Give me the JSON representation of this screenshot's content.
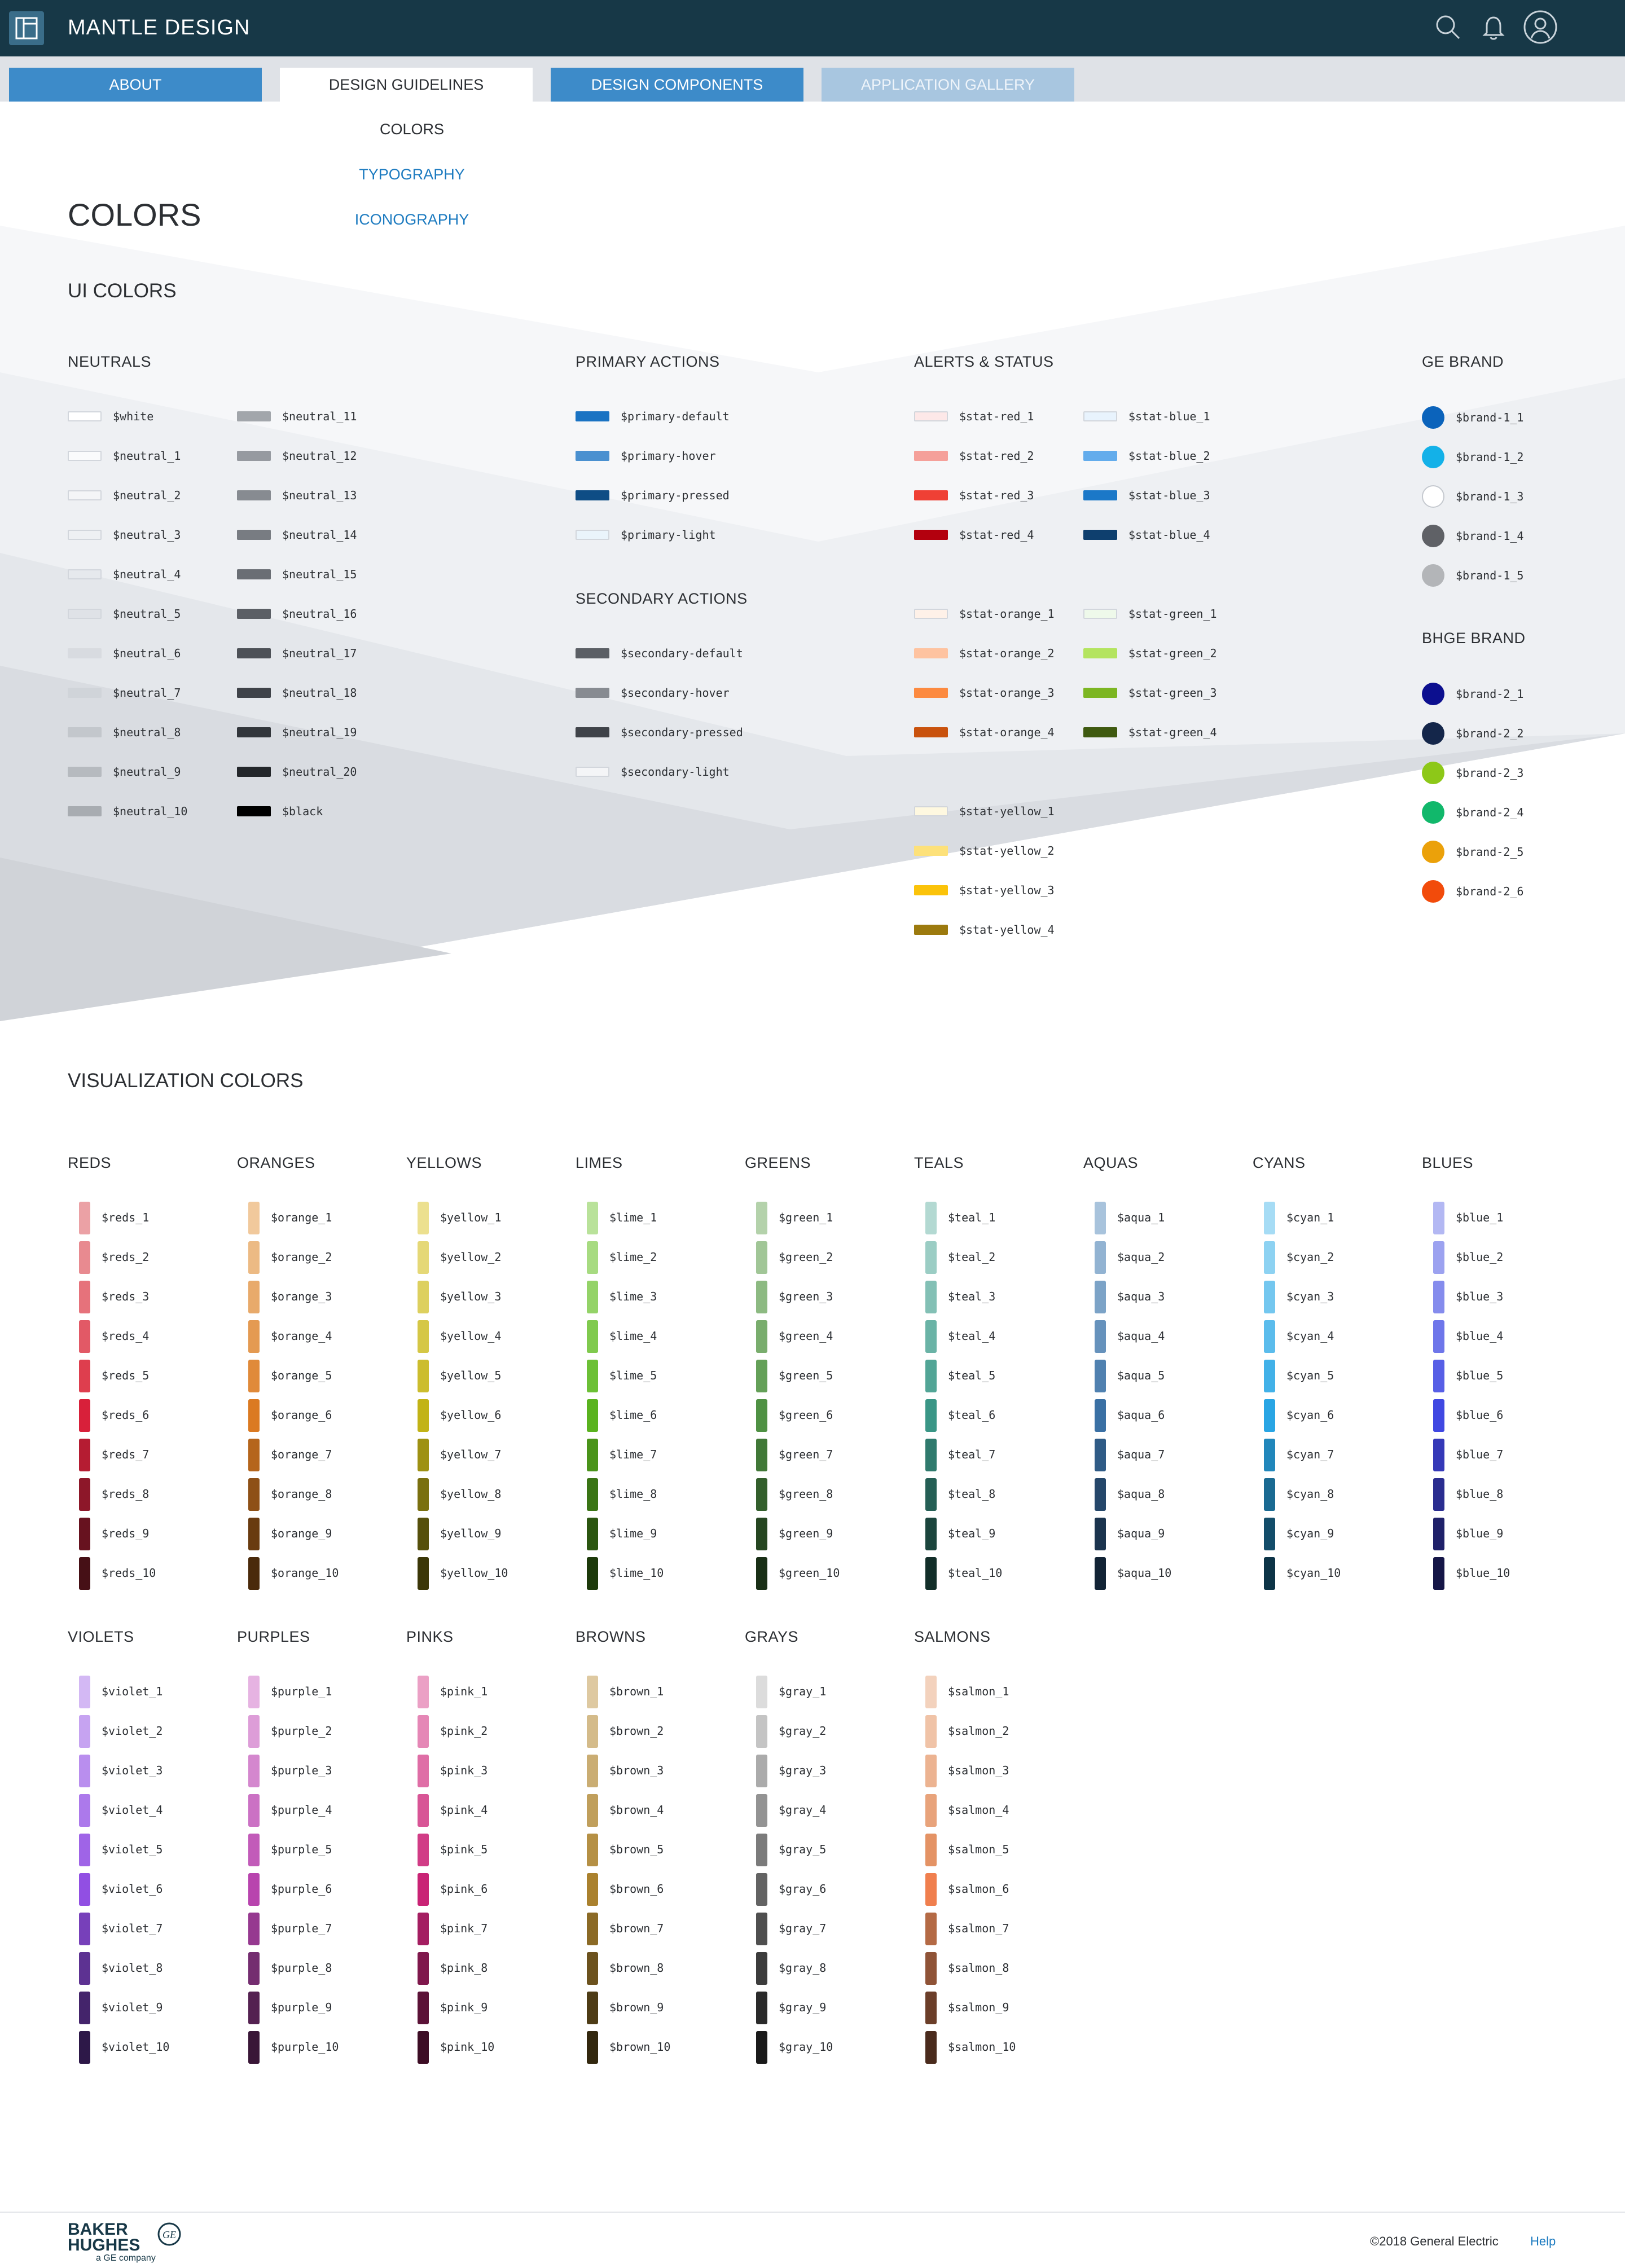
{
  "app": {
    "title": "MANTLE DESIGN"
  },
  "tabs": [
    {
      "label": "ABOUT"
    },
    {
      "label": "DESIGN GUIDELINES"
    },
    {
      "label": "DESIGN COMPONENTS"
    },
    {
      "label": "APPLICATION GALLERY"
    }
  ],
  "subnav": [
    {
      "label": "COLORS"
    },
    {
      "label": "TYPOGRAPHY"
    },
    {
      "label": "ICONOGRAPHY"
    }
  ],
  "page_title": "COLORS",
  "ui_colors": {
    "title": "UI COLORS",
    "neutrals": {
      "title": "NEUTRALS",
      "col1": [
        {
          "label": "$white",
          "color": "#ffffff",
          "outline": true
        },
        {
          "label": "$neutral_1",
          "color": "#fafbfc",
          "outline": true
        },
        {
          "label": "$neutral_2",
          "color": "#f4f5f7",
          "outline": true
        },
        {
          "label": "$neutral_3",
          "color": "#eef0f3",
          "outline": true
        },
        {
          "label": "$neutral_4",
          "color": "#e6e9ed",
          "outline": true
        },
        {
          "label": "$neutral_5",
          "color": "#dfe2e7",
          "outline": true
        },
        {
          "label": "$neutral_6",
          "color": "#d8dbe0"
        },
        {
          "label": "$neutral_7",
          "color": "#d0d4d9"
        },
        {
          "label": "$neutral_8",
          "color": "#c3c7cc"
        },
        {
          "label": "$neutral_9",
          "color": "#b6babf"
        },
        {
          "label": "$neutral_10",
          "color": "#a8acb1"
        }
      ],
      "col2": [
        {
          "label": "$neutral_11",
          "color": "#a2a6ab"
        },
        {
          "label": "$neutral_12",
          "color": "#969aa0"
        },
        {
          "label": "$neutral_13",
          "color": "#878b91"
        },
        {
          "label": "$neutral_14",
          "color": "#787c82"
        },
        {
          "label": "$neutral_15",
          "color": "#6a6e74"
        },
        {
          "label": "$neutral_16",
          "color": "#5b5f65"
        },
        {
          "label": "$neutral_17",
          "color": "#4d5157"
        },
        {
          "label": "$neutral_18",
          "color": "#3f4349"
        },
        {
          "label": "$neutral_19",
          "color": "#32363b"
        },
        {
          "label": "$neutral_20",
          "color": "#24272b"
        },
        {
          "label": "$black",
          "color": "#000000"
        }
      ]
    },
    "primary": {
      "title": "PRIMARY ACTIONS",
      "items": [
        {
          "label": "$primary-default",
          "color": "#1a73c3"
        },
        {
          "label": "$primary-hover",
          "color": "#4a90d0"
        },
        {
          "label": "$primary-pressed",
          "color": "#0e4d85"
        },
        {
          "label": "$primary-light",
          "color": "#eaf4fb",
          "outline": true
        }
      ]
    },
    "secondary": {
      "title": "SECONDARY ACTIONS",
      "items": [
        {
          "label": "$secondary-default",
          "color": "#5b5f65"
        },
        {
          "label": "$secondary-hover",
          "color": "#878b91"
        },
        {
          "label": "$secondary-pressed",
          "color": "#3f4349"
        },
        {
          "label": "$secondary-light",
          "color": "#f4f5f7",
          "outline": true
        }
      ]
    },
    "alerts": {
      "title": "ALERTS & STATUS",
      "col1": [
        {
          "label": "$stat-red_1",
          "color": "#fde8e8",
          "outline": true
        },
        {
          "label": "$stat-red_2",
          "color": "#f5a09a"
        },
        {
          "label": "$stat-red_3",
          "color": "#ef4035"
        },
        {
          "label": "$stat-red_4",
          "color": "#b3000e"
        },
        {
          "label": "$stat-orange_1",
          "color": "#fef1e8",
          "outline": true
        },
        {
          "label": "$stat-orange_2",
          "color": "#fec3a0"
        },
        {
          "label": "$stat-orange_3",
          "color": "#fc8a40"
        },
        {
          "label": "$stat-orange_4",
          "color": "#c9520d"
        },
        {
          "label": "$stat-yellow_1",
          "color": "#fef8e0",
          "outline": true
        },
        {
          "label": "$stat-yellow_2",
          "color": "#fde17a"
        },
        {
          "label": "$stat-yellow_3",
          "color": "#fbc30a"
        },
        {
          "label": "$stat-yellow_4",
          "color": "#9c7a0e"
        }
      ],
      "col2": [
        {
          "label": "$stat-blue_1",
          "color": "#e8f3fd",
          "outline": true
        },
        {
          "label": "$stat-blue_2",
          "color": "#63acec"
        },
        {
          "label": "$stat-blue_3",
          "color": "#1b78c8"
        },
        {
          "label": "$stat-blue_4",
          "color": "#0e3f6e"
        },
        {
          "label": "$stat-green_1",
          "color": "#eef9ea",
          "outline": true
        },
        {
          "label": "$stat-green_2",
          "color": "#b4e45f"
        },
        {
          "label": "$stat-green_3",
          "color": "#7cb622"
        },
        {
          "label": "$stat-green_4",
          "color": "#3f5a10"
        }
      ]
    },
    "ge_brand": {
      "title": "GE BRAND",
      "items": [
        {
          "label": "$brand-1_1",
          "color": "#0b63bb"
        },
        {
          "label": "$brand-1_2",
          "color": "#13b1e8"
        },
        {
          "label": "$brand-1_3",
          "color": "#ffffff",
          "outline": true
        },
        {
          "label": "$brand-1_4",
          "color": "#5f6166"
        },
        {
          "label": "$brand-1_5",
          "color": "#b3b5b8"
        }
      ]
    },
    "bhge_brand": {
      "title": "BHGE BRAND",
      "items": [
        {
          "label": "$brand-2_1",
          "color": "#0c0f8f"
        },
        {
          "label": "$brand-2_2",
          "color": "#14264a"
        },
        {
          "label": "$brand-2_3",
          "color": "#8dc818"
        },
        {
          "label": "$brand-2_4",
          "color": "#11b86b"
        },
        {
          "label": "$brand-2_5",
          "color": "#eba10a"
        },
        {
          "label": "$brand-2_6",
          "color": "#f24b0b"
        }
      ]
    }
  },
  "viz_colors": {
    "title": "VISUALIZATION COLORS",
    "groups": [
      {
        "title": "REDS",
        "labels": [
          "$reds_1",
          "$reds_2",
          "$reds_3",
          "$reds_4",
          "$reds_5",
          "$reds_6",
          "$reds_7",
          "$reds_8",
          "$reds_9",
          "$reds_10"
        ],
        "colors": [
          "#eba1a5",
          "#e88a90",
          "#e6727b",
          "#e25966",
          "#de3e4e",
          "#d8203a",
          "#b51c32",
          "#8d1729",
          "#67121f",
          "#461016"
        ]
      },
      {
        "title": "ORANGES",
        "labels": [
          "$orange_1",
          "$orange_2",
          "$orange_3",
          "$orange_4",
          "$orange_5",
          "$orange_6",
          "$orange_7",
          "$orange_8",
          "$orange_9",
          "$orange_10"
        ],
        "colors": [
          "#f1c99c",
          "#ecba84",
          "#e8aa6b",
          "#e49a52",
          "#e08a3a",
          "#db7a22",
          "#b5651c",
          "#8e5016",
          "#693b10",
          "#4a2a0b"
        ]
      },
      {
        "title": "YELLOWS",
        "labels": [
          "$yellow_1",
          "$yellow_2",
          "$yellow_3",
          "$yellow_4",
          "$yellow_5",
          "$yellow_6",
          "$yellow_7",
          "$yellow_8",
          "$yellow_9",
          "$yellow_10"
        ],
        "colors": [
          "#ece08f",
          "#e5d877",
          "#ddd05f",
          "#d5c746",
          "#ccbd2e",
          "#c2b316",
          "#9e9113",
          "#7a700f",
          "#56500b",
          "#3b3708"
        ]
      },
      {
        "title": "LIMES",
        "labels": [
          "$lime_1",
          "$lime_2",
          "$lime_3",
          "$lime_4",
          "$lime_5",
          "$lime_6",
          "$lime_7",
          "$lime_8",
          "$lime_9",
          "$lime_10"
        ],
        "colors": [
          "#b9e29a",
          "#a7db81",
          "#94d368",
          "#80ca4e",
          "#6cc036",
          "#5ab31f",
          "#4a941a",
          "#3a7515",
          "#2b5610",
          "#1d3a0b"
        ]
      },
      {
        "title": "GREENS",
        "labels": [
          "$green_1",
          "$green_2",
          "$green_3",
          "$green_4",
          "$green_5",
          "$green_6",
          "$green_7",
          "$green_8",
          "$green_9",
          "$green_10"
        ],
        "colors": [
          "#b4d2ab",
          "#a1c697",
          "#8dba82",
          "#79ad6d",
          "#64a058",
          "#4f9143",
          "#417837",
          "#335f2c",
          "#264621",
          "#192f16"
        ]
      },
      {
        "title": "TEALS",
        "labels": [
          "$teal_1",
          "$teal_2",
          "$teal_3",
          "$teal_4",
          "$teal_5",
          "$teal_6",
          "$teal_7",
          "$teal_8",
          "$teal_9",
          "$teal_10"
        ],
        "colors": [
          "#b3d9d2",
          "#9bcdc4",
          "#83c0b5",
          "#6ab3a6",
          "#52a596",
          "#3a9686",
          "#2f7a6d",
          "#255f55",
          "#1b453d",
          "#122e29"
        ]
      },
      {
        "title": "AQUAS",
        "labels": [
          "$aqua_1",
          "$aqua_2",
          "$aqua_3",
          "$aqua_4",
          "$aqua_5",
          "$aqua_6",
          "$aqua_7",
          "$aqua_8",
          "$aqua_9",
          "$aqua_10"
        ],
        "colors": [
          "#a8c3dc",
          "#92b3d2",
          "#7ca3c7",
          "#6692bc",
          "#5081b0",
          "#3a70a4",
          "#2f5b86",
          "#25476a",
          "#1b344e",
          "#122335"
        ]
      },
      {
        "title": "CYANS",
        "labels": [
          "$cyan_1",
          "$cyan_2",
          "$cyan_3",
          "$cyan_4",
          "$cyan_5",
          "$cyan_6",
          "$cyan_7",
          "$cyan_8",
          "$cyan_9",
          "$cyan_10"
        ],
        "colors": [
          "#a6dcf5",
          "#8dd2f2",
          "#74c7ef",
          "#5bbcec",
          "#42b1e8",
          "#29a5e4",
          "#2187bb",
          "#1a6a92",
          "#134d6a",
          "#0d3447"
        ]
      },
      {
        "title": "BLUES",
        "labels": [
          "$blue_1",
          "$blue_2",
          "$blue_3",
          "$blue_4",
          "$blue_5",
          "$blue_6",
          "$blue_7",
          "$blue_8",
          "$blue_9",
          "$blue_10"
        ],
        "colors": [
          "#b3b8f3",
          "#9ca2f0",
          "#858ced",
          "#6e76ea",
          "#575fe6",
          "#4048e2",
          "#3539b8",
          "#2a2d90",
          "#1f216a",
          "#151647"
        ]
      },
      {
        "title": "VIOLETS",
        "labels": [
          "$violet_1",
          "$violet_2",
          "$violet_3",
          "$violet_4",
          "$violet_5",
          "$violet_6",
          "$violet_7",
          "$violet_8",
          "$violet_9",
          "$violet_10"
        ],
        "colors": [
          "#d3b8f4",
          "#c6a3f1",
          "#b98eee",
          "#ac79eb",
          "#9f64e7",
          "#914fe3",
          "#7740ba",
          "#5d3292",
          "#44246b",
          "#2d1848"
        ]
      },
      {
        "title": "PURPLES",
        "labels": [
          "$purple_1",
          "$purple_2",
          "$purple_3",
          "$purple_4",
          "$purple_5",
          "$purple_6",
          "$purple_7",
          "$purple_8",
          "$purple_9",
          "$purple_10"
        ],
        "colors": [
          "#e6b3e2",
          "#dd9dd8",
          "#d487ce",
          "#cb71c4",
          "#c25bb9",
          "#b844ae",
          "#963990",
          "#742d70",
          "#542151",
          "#391637"
        ]
      },
      {
        "title": "PINKS",
        "labels": [
          "$pink_1",
          "$pink_2",
          "$pink_3",
          "$pink_4",
          "$pink_5",
          "$pink_6",
          "$pink_7",
          "$pink_8",
          "$pink_9",
          "$pink_10"
        ],
        "colors": [
          "#eba0c5",
          "#e587b6",
          "#df6ea6",
          "#d85596",
          "#d13c86",
          "#c92375",
          "#a41e61",
          "#7f184c",
          "#5b1237",
          "#3d0d25"
        ]
      },
      {
        "title": "BROWNS",
        "labels": [
          "$brown_1",
          "$brown_2",
          "$brown_3",
          "$brown_4",
          "$brown_5",
          "$brown_6",
          "$brown_7",
          "$brown_8",
          "$brown_9",
          "$brown_10"
        ],
        "colors": [
          "#dec9a1",
          "#d4bb8a",
          "#caad73",
          "#c09f5c",
          "#b59045",
          "#aa812e",
          "#8b6a26",
          "#6c521e",
          "#4e3c16",
          "#33280f"
        ]
      },
      {
        "title": "GRAYS",
        "labels": [
          "$gray_1",
          "$gray_2",
          "$gray_3",
          "$gray_4",
          "$gray_5",
          "$gray_6",
          "$gray_7",
          "$gray_8",
          "$gray_9",
          "$gray_10"
        ],
        "colors": [
          "#dcdcdc",
          "#c4c4c4",
          "#ababab",
          "#939393",
          "#7b7b7b",
          "#636363",
          "#4f4f4f",
          "#3c3c3c",
          "#2a2a2a",
          "#1a1a1a"
        ]
      },
      {
        "title": "SALMONS",
        "labels": [
          "$salmon_1",
          "$salmon_2",
          "$salmon_3",
          "$salmon_4",
          "$salmon_5",
          "$salmon_6",
          "$salmon_7",
          "$salmon_8",
          "$salmon_9",
          "$salmon_10"
        ],
        "colors": [
          "#f3d2bd",
          "#f0c3a7",
          "#ecb391",
          "#e8a37b",
          "#e49365",
          "#f07f4e",
          "#b46a45",
          "#8f5337",
          "#6b3e29",
          "#4a2b1d"
        ]
      }
    ]
  },
  "footer": {
    "logo_text": "BAKER HUGHES",
    "logo_sub": "a GE company",
    "copyright": "©2018 General Electric",
    "help": "Help"
  }
}
